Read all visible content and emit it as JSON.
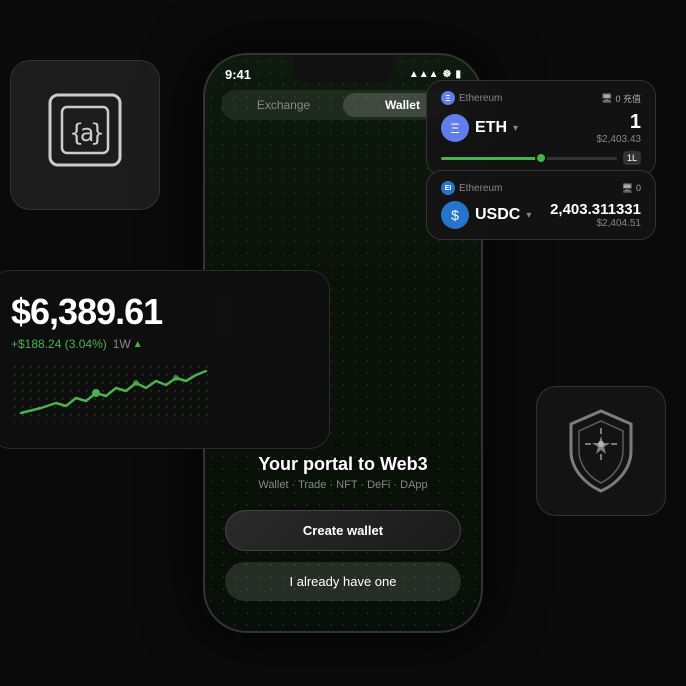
{
  "page": {
    "background": "#0a0a0a"
  },
  "phone": {
    "status_time": "9:41",
    "status_icons": "▲▲▲",
    "tabs": [
      {
        "label": "Exchange",
        "active": false
      },
      {
        "label": "Wallet",
        "active": true
      }
    ],
    "portal_title": "Your portal to Web3",
    "portal_subtitle": "Wallet · Trade · NFT · DeFi · DApp",
    "btn_create": "Create wallet",
    "btn_have_one": "I already have one"
  },
  "card_eth": {
    "chain": "Ethereum",
    "token": "ETH",
    "amount": "1",
    "usd": "$2,403.43",
    "badge": "0 充值"
  },
  "card_usdc": {
    "chain": "Ethereum",
    "token": "USDC",
    "amount": "2,403.311331",
    "usd": "$2,404.51",
    "badge": "0"
  },
  "card_portfolio": {
    "amount": "$6,389.61",
    "change": "+$188.24 (3.04%)",
    "period": "1W",
    "arrow": "▲"
  },
  "card_brand": {
    "icon": "{a}"
  },
  "card_shield": {
    "icon": "shield"
  }
}
